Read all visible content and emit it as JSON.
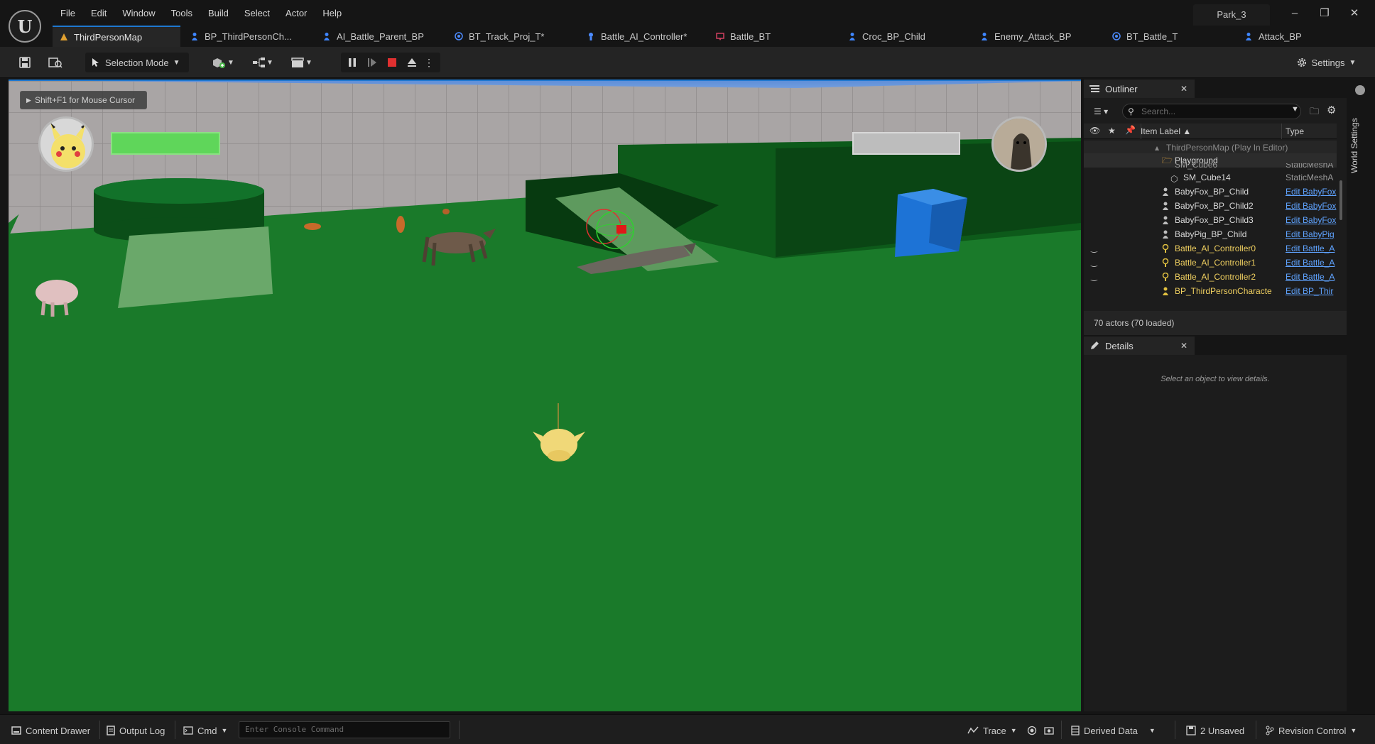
{
  "menu": [
    "File",
    "Edit",
    "Window",
    "Tools",
    "Build",
    "Select",
    "Actor",
    "Help"
  ],
  "project_name": "Park_3",
  "tabs": [
    {
      "label": "ThirdPersonMap",
      "icon": "level-icon",
      "active": true
    },
    {
      "label": "BP_ThirdPersonCh...",
      "icon": "blueprint-pawn-icon"
    },
    {
      "label": "AI_Battle_Parent_BP",
      "icon": "blueprint-pawn-icon"
    },
    {
      "label": "BT_Track_Proj_T*",
      "icon": "behavior-task-icon"
    },
    {
      "label": "Battle_AI_Controller*",
      "icon": "ai-controller-icon"
    },
    {
      "label": "Battle_BT",
      "icon": "behavior-tree-icon"
    },
    {
      "label": "Croc_BP_Child",
      "icon": "blueprint-pawn-icon"
    },
    {
      "label": "Enemy_Attack_BP",
      "icon": "blueprint-pawn-icon"
    },
    {
      "label": "BT_Battle_T",
      "icon": "behavior-task-icon"
    },
    {
      "label": "Attack_BP",
      "icon": "blueprint-pawn-icon"
    }
  ],
  "toolbar": {
    "selection_mode": "Selection Mode",
    "settings": "Settings"
  },
  "viewport": {
    "hint": "Shift+F1 for Mouse Cursor",
    "player_health": 1.0,
    "enemy_health": 1.0
  },
  "outliner": {
    "title": "Outliner",
    "search_placeholder": "Search...",
    "col_label": "Item Label",
    "col_type": "Type",
    "map_row": "ThirdPersonMap (Play In Editor)",
    "folder_row": "Playground",
    "partial_row": {
      "label": "SM_Cube6",
      "type": "StaticMeshA"
    },
    "rows": [
      {
        "label": "SM_Cube14",
        "type": "StaticMeshA",
        "link": false,
        "icon": "static-mesh-icon"
      },
      {
        "label": "BabyFox_BP_Child",
        "type": "Edit BabyFox",
        "link": true,
        "icon": "pawn-icon"
      },
      {
        "label": "BabyFox_BP_Child2",
        "type": "Edit BabyFox",
        "link": true,
        "icon": "pawn-icon"
      },
      {
        "label": "BabyFox_BP_Child3",
        "type": "Edit BabyFox",
        "link": true,
        "icon": "pawn-icon"
      },
      {
        "label": "BabyPig_BP_Child",
        "type": "Edit BabyPig",
        "link": true,
        "icon": "pawn-icon"
      },
      {
        "label": "Battle_AI_Controller0",
        "type": "Edit Battle_A",
        "link": true,
        "icon": "ai-controller-icon",
        "hidden": true
      },
      {
        "label": "Battle_AI_Controller1",
        "type": "Edit Battle_A",
        "link": true,
        "icon": "ai-controller-icon",
        "hidden": true
      },
      {
        "label": "Battle_AI_Controller2",
        "type": "Edit Battle_A",
        "link": true,
        "icon": "ai-controller-icon",
        "hidden": true
      },
      {
        "label": "BP_ThirdPersonCharacte",
        "type": "Edit BP_Thir",
        "link": true,
        "icon": "pawn-icon"
      }
    ],
    "status": "70 actors (70 loaded)"
  },
  "details": {
    "title": "Details",
    "empty": "Select an object to view details."
  },
  "world_settings": "World Settings",
  "bottom": {
    "content_drawer": "Content Drawer",
    "output_log": "Output Log",
    "cmd": "Cmd",
    "console_placeholder": "Enter Console Command",
    "trace": "Trace",
    "derived_data": "Derived Data",
    "unsaved": "2 Unsaved",
    "revision_control": "Revision Control"
  },
  "colors": {
    "accent": "#1e78d0",
    "floor": "#1a7a2a",
    "link": "#5fa3ff",
    "health": "#5fd65a"
  }
}
